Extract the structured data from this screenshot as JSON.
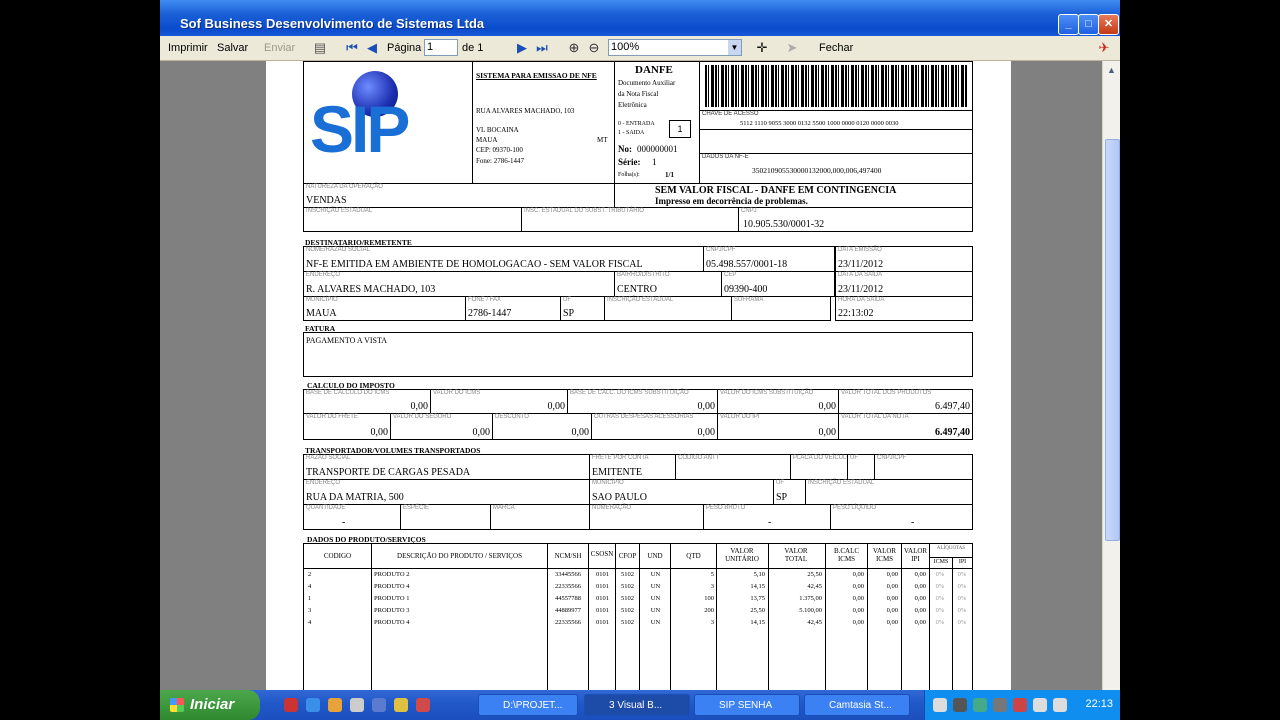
{
  "window": {
    "title": "Sof Business Desenvolvimento de Sistemas Ltda",
    "min": "_",
    "max": "□",
    "close": "✕"
  },
  "toolbar": {
    "print": "Imprimir",
    "save": "Salvar",
    "send": "Enviar",
    "page_label": "Página",
    "page_value": "1",
    "of_label": "de 1",
    "zoom": "100%",
    "close": "Fechar"
  },
  "doc": {
    "logo": "SIP",
    "emitter": {
      "system": "SISTEMA PARA EMISSAO DE NFE",
      "street": "RUA ALVARES MACHADO, 103",
      "district": "VL BOCAINA",
      "city": "MAUA",
      "state": "MT",
      "cep": "CEP: 09370-100",
      "phone": "Fone: 2786-1447"
    },
    "danfe": {
      "title": "DANFE",
      "sub1": "Documento Auxiliar",
      "sub2": "da Nota Fiscal",
      "sub3": "Eletrônica",
      "entrada": "0 - ENTRADA",
      "saida": "1 - SAIDA",
      "type_value": "1",
      "no_label": "No:",
      "no_value": "000000001",
      "serie_label": "Série:",
      "serie_value": "1",
      "folha_label": "Folha(s):",
      "folha_value": "1/1"
    },
    "access_key_label": "Chave de Acesso",
    "access_key": "5112 1110 9055 3000 0132 5500 1000 0000 0120 0000 0030",
    "nfe_data_label": "Dados da NF-e",
    "nfe_data": "350210905530000132000,000,006,497400",
    "nature_label": "NATUREZA DA OPERAÇÃO",
    "nature": "VENDAS",
    "contingency1": "SEM VALOR FISCAL -  DANFE EM CONTINGENCIA",
    "contingency2": "Impresso em decorrência de problemas.",
    "ie_label": "INSCRIÇÃO ESTADUAL",
    "ie_st_label": "INSC. ESTADUAL DO SUBST. TRIBUTÁRIO",
    "cnpj_label": "CNPJ",
    "cnpj": "10.905.530/0001-32",
    "recipient": {
      "section": "DESTINATARIO/REMETENTE",
      "name_label": "NOME/RAZÃO SOCIAL",
      "name": "NF-E EMITIDA EM AMBIENTE DE HOMOLOGACAO - SEM VALOR FISCAL",
      "cnpj_label": "CNPJ/CPF",
      "cnpj": "05.498.557/0001-18",
      "emission_label": "DATA EMISSÃO",
      "emission": "23/11/2012",
      "address_label": "ENDEREÇO",
      "address": "R. ALVARES MACHADO, 103",
      "district_label": "BAIRRO/DISTRITO",
      "district": "CENTRO",
      "cep_label": "CEP",
      "cep": "09390-400",
      "exit_label": "DATA DA SAÍDA",
      "exit": "23/11/2012",
      "city_label": "MUNICÍPIO",
      "city": "MAUA",
      "phone_label": "FONE / FAX",
      "phone": "2786-1447",
      "uf_label": "UF",
      "uf": "SP",
      "ie_label": "INSCRIÇÃO ESTADUAL",
      "suframa_label": "SUFRAMA",
      "time_label": "HORA DA SAÍDA",
      "time": "22:13:02"
    },
    "invoice": {
      "section": "FATURA",
      "text": "PAGAMENTO A VISTA"
    },
    "tax": {
      "section": "CALCULO DO IMPOSTO",
      "row1": [
        {
          "label": "BASE DE CÁLCULO DO ICMS",
          "value": "0,00"
        },
        {
          "label": "VALOR DO ICMS",
          "value": "0,00"
        },
        {
          "label": "BASE DE CÁLC. DO ICMS SUBSTITUIÇÃO",
          "value": "0,00"
        },
        {
          "label": "VALOR DO ICMS SUBSTITUIÇÃO",
          "value": "0,00"
        },
        {
          "label": "VALOR TOTAL DOS PRODUTOS",
          "value": "6.497,40"
        }
      ],
      "row2": [
        {
          "label": "VALOR DO FRETE",
          "value": "0,00"
        },
        {
          "label": "VALOR DO SEGURO",
          "value": "0,00"
        },
        {
          "label": "DESCONTO",
          "value": "0,00"
        },
        {
          "label": "OUTRAS DESPESAS ACESSÓRIAS",
          "value": "0,00"
        },
        {
          "label": "VALOR DO IPI",
          "value": "0,00"
        },
        {
          "label": "VALOR TOTAL DA NOTA",
          "value": "6.497,40"
        }
      ]
    },
    "carrier": {
      "section": "TRANSPORTADOR/VOLUMES TRANSPORTADOS",
      "name_label": "RAZÃO SOCIAL",
      "name": "TRANSPORTE DE CARGAS PESADA",
      "freight_label": "FRETE POR CONTA",
      "freight": "EMITENTE",
      "antt_label": "CÓDIGO ANTT",
      "plate_label": "PLACA DO VEÍCULO",
      "uf_label": "UF",
      "cnpj_label": "CNPJ/CPF",
      "address_label": "ENDEREÇO",
      "address": "RUA DA MATRIA, 500",
      "city_label": "MUNICÍPIO",
      "city": "SAO PAULO",
      "uf2_label": "UF",
      "uf2": "SP",
      "ie_label": "INSCRIÇÃO ESTADUAL",
      "qty_label": "QUANTIDADE",
      "qty": "-",
      "species_label": "ESPÉCIE",
      "brand_label": "MARCA",
      "number_label": "NUMERAÇÃO",
      "gross_label": "PESO BRUTO",
      "gross": "-",
      "net_label": "PESO LÍQUIDO",
      "net": "-"
    },
    "products": {
      "section": "DADOS DO PRODUTO/SERVIÇOS",
      "headers": [
        "CODIGO",
        "DESCRIÇÃO DO PRODUTO / SERVIÇOS",
        "NCM/SH",
        "CSOSN",
        "CFOP",
        "UND",
        "QTD",
        "VALOR UNITÁRIO",
        "VALOR TOTAL",
        "B.CALC ICMS",
        "VALOR ICMS",
        "VALOR IPI",
        "ALÍQUOTAS",
        "ICMS",
        "IPI"
      ],
      "rows": [
        [
          "2",
          "PRODUTO 2",
          "33445566",
          "0101",
          "5102",
          "UN",
          "5",
          "5,10",
          "25,50",
          "0,00",
          "0,00",
          "0,00",
          "0%",
          "0%"
        ],
        [
          "4",
          "PRODUTO 4",
          "22335566",
          "0101",
          "5102",
          "UN",
          "3",
          "14,15",
          "42,45",
          "0,00",
          "0,00",
          "0,00",
          "0%",
          "0%"
        ],
        [
          "1",
          "PRODUTO 1",
          "44557788",
          "0101",
          "5102",
          "UN",
          "100",
          "13,75",
          "1.375,00",
          "0,00",
          "0,00",
          "0,00",
          "0%",
          "0%"
        ],
        [
          "3",
          "PRODUTO 3",
          "44889977",
          "0101",
          "5102",
          "UN",
          "200",
          "25,50",
          "5.100,00",
          "0,00",
          "0,00",
          "0,00",
          "0%",
          "0%"
        ],
        [
          "4",
          "PRODUTO 4",
          "22335566",
          "0101",
          "5102",
          "UN",
          "3",
          "14,15",
          "42,45",
          "0,00",
          "0,00",
          "0,00",
          "0%",
          "0%"
        ]
      ]
    }
  },
  "taskbar": {
    "start": "Iniciar",
    "tasks": [
      "D:\\PROJET...",
      "3 Visual B...",
      "SIP SENHA",
      "Camtasia St..."
    ],
    "clock": "22:13"
  }
}
